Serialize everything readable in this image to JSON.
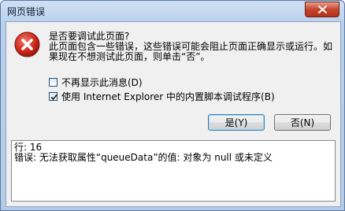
{
  "window": {
    "title": "网页错误",
    "close_icon": "close-icon"
  },
  "message": {
    "icon": "error-icon",
    "line1": "是否要调试此页面?",
    "line2": "此页面包含一些错误，这些错误可能会阻止页面正确显示或运行。如",
    "line3": "果现在不想测试此页面，则单击“否”。"
  },
  "options": {
    "dont_show": {
      "label": "不再显示此消息(D)",
      "checked": false
    },
    "use_ie_debugger": {
      "label": "使用 Internet Explorer 中的内置脚本调试程序(B)",
      "checked": true
    }
  },
  "buttons": {
    "yes": "是(Y)",
    "no": "否(N)"
  },
  "details": {
    "line_row": "行: 16",
    "error_row": "错误: 无法获取属性“queueData”的值: 对象为 null 或未定义"
  },
  "colors": {
    "accent": "#3c7fb1",
    "error_red": "#c8281e",
    "close_red": "#c7452c"
  }
}
